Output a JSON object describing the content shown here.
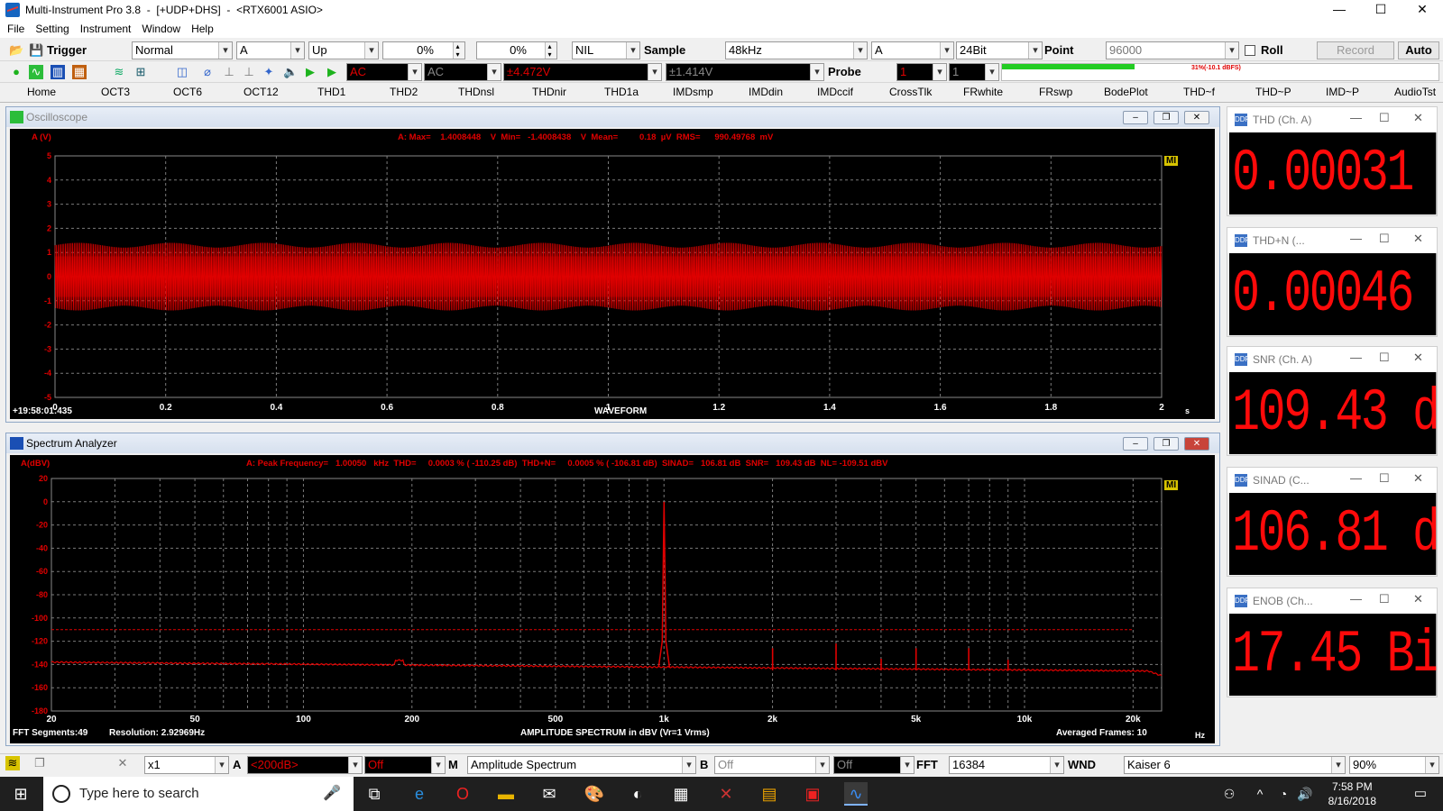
{
  "window": {
    "title": "Multi-Instrument Pro 3.8  -  [+UDP+DHS]  -  <RTX6001 ASIO>"
  },
  "menu": [
    "File",
    "Setting",
    "Instrument",
    "Window",
    "Help"
  ],
  "toolbar1": {
    "trigger_label": "Trigger",
    "trigger_mode": "Normal",
    "trigger_channel": "A",
    "trigger_edge": "Up",
    "trigger_level": "0%",
    "trigger_delay": "0%",
    "nil": "NIL",
    "sample_label": "Sample",
    "sample_rate": "48kHz",
    "channel": "A",
    "bits": "24Bit",
    "point_label": "Point",
    "points": "96000",
    "roll_label": "Roll",
    "record_label": "Record",
    "auto_label": "Auto"
  },
  "toolbar2": {
    "coupling_a": "AC",
    "coupling_b": "AC",
    "range_a": "±4.472V",
    "range_b": "±1.414V",
    "probe_label": "Probe",
    "probe_a": "1",
    "probe_b": "1",
    "cpu_text": "31%(-10.1 dBFS)",
    "cpu_level": 0.52
  },
  "tabs": [
    "Home",
    "OCT3",
    "OCT6",
    "OCT12",
    "THD1",
    "THD2",
    "THDnsl",
    "THDnir",
    "THD1a",
    "IMDsmp",
    "IMDdin",
    "IMDccif",
    "CrossTlk",
    "FRwhite",
    "FRswp",
    "BodePlot",
    "THD~f",
    "THD~P",
    "IMD~P",
    "AudioTst"
  ],
  "oscilloscope": {
    "title": "Oscilloscope",
    "ylabel": "A (V)",
    "readout": "A: Max=    1.4008448    V  Min=   -1.4008438    V  Mean=         0.18  µV  RMS=      990.49768  mV",
    "yticks": [
      "5",
      "4",
      "3",
      "2",
      "1",
      "0",
      "-1",
      "-2",
      "-3",
      "-4",
      "-5"
    ],
    "xticks": [
      "0",
      "0.2",
      "0.4",
      "0.6",
      "0.8",
      "1",
      "1.2",
      "1.4",
      "1.6",
      "1.8",
      "2"
    ],
    "xunit": "s",
    "xlabel": "WAVEFORM",
    "timestamp": "+19:58:01:435",
    "logo": "MI"
  },
  "spectrum": {
    "title": "Spectrum Analyzer",
    "ylabel": "A(dBV)",
    "readout": "A: Peak Frequency=   1.00050   kHz  THD=     0.0003 % ( -110.25 dB)  THD+N=     0.0005 % ( -106.81 dB)  SINAD=   106.81 dB  SNR=   109.43 dB  NL= -109.51 dBV",
    "yticks": [
      "20",
      "0",
      "-20",
      "-40",
      "-60",
      "-80",
      "-100",
      "-120",
      "-140",
      "-160",
      "-180"
    ],
    "xticks": [
      "20",
      "50",
      "100",
      "200",
      "500",
      "1k",
      "2k",
      "5k",
      "10k",
      "20k"
    ],
    "xunit": "Hz",
    "xlabel": "AMPLITUDE SPECTRUM in dBV (Vr=1 Vrms)",
    "segments": "FFT Segments:49",
    "resolution": "Resolution: 2.92969Hz",
    "frames": "Averaged Frames: 10",
    "logo": "MI",
    "noise_line_db": -110,
    "harmonics": [
      {
        "f": 2001,
        "db": -126
      },
      {
        "f": 3001,
        "db": -122
      },
      {
        "f": 4002,
        "db": -135
      },
      {
        "f": 5002,
        "db": -126
      },
      {
        "f": 7003,
        "db": -126
      },
      {
        "f": 9004,
        "db": -136
      }
    ],
    "fundamental": {
      "f": 1000.5,
      "db": -0.08
    }
  },
  "bottombar": {
    "zoom": "x1",
    "ch_a": "A",
    "range_a": "<200dB>",
    "off_a": "Off",
    "m_label": "M",
    "mode": "Amplitude Spectrum",
    "ch_b": "B",
    "off_b": "Off",
    "off_c": "Off",
    "fft_label": "FFT",
    "fft_size": "16384",
    "wnd_label": "WND",
    "window": "Kaiser 6",
    "overlap": "90%"
  },
  "meters": [
    {
      "title": "THD (Ch. A)",
      "value": "0.00031 %"
    },
    {
      "title": "THD+N (...",
      "value": "0.00046 %"
    },
    {
      "title": "SNR (Ch. A)",
      "value": "109.43 dB"
    },
    {
      "title": "SINAD (C...",
      "value": "106.81 dB"
    },
    {
      "title": "ENOB (Ch...",
      "value": "17.45 Bit"
    }
  ],
  "taskbar": {
    "search_placeholder": "Type here to search",
    "time": "7:58 PM",
    "date": "8/16/2018"
  },
  "colors": {
    "trace": "#e00000",
    "grid": "#7a7a7a",
    "background": "#000000"
  }
}
